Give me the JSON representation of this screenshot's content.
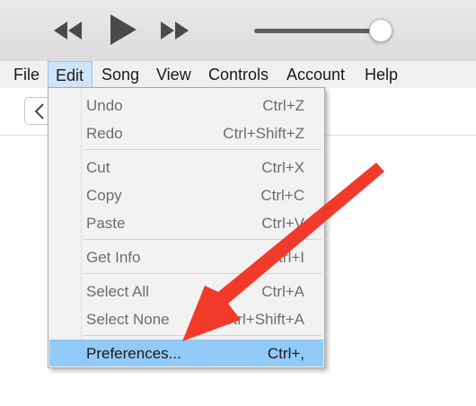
{
  "player": {
    "prev_icon": "rewind-icon",
    "play_icon": "play-icon",
    "next_icon": "fast-forward-icon",
    "volume_level": 0.95
  },
  "menubar": {
    "items": [
      "File",
      "Edit",
      "Song",
      "View",
      "Controls",
      "Account",
      "Help"
    ],
    "active": "Edit"
  },
  "toolbar": {
    "back_icon": "chevron-left-icon"
  },
  "edit_menu": {
    "undo": {
      "label": "Undo",
      "shortcut": "Ctrl+Z"
    },
    "redo": {
      "label": "Redo",
      "shortcut": "Ctrl+Shift+Z"
    },
    "cut": {
      "label": "Cut",
      "shortcut": "Ctrl+X"
    },
    "copy": {
      "label": "Copy",
      "shortcut": "Ctrl+C"
    },
    "paste": {
      "label": "Paste",
      "shortcut": "Ctrl+V"
    },
    "get_info": {
      "label": "Get Info",
      "shortcut": "Ctrl+I"
    },
    "select_all": {
      "label": "Select All",
      "shortcut": "Ctrl+A"
    },
    "select_none": {
      "label": "Select None",
      "shortcut": "Ctrl+Shift+A"
    },
    "preferences": {
      "label": "Preferences...",
      "shortcut": "Ctrl+,"
    },
    "highlighted": "preferences"
  },
  "annotation": {
    "arrow_color": "#f23a2b"
  },
  "colors": {
    "highlight": "#91c9f7",
    "disabled_text": "#6d6d6d"
  }
}
